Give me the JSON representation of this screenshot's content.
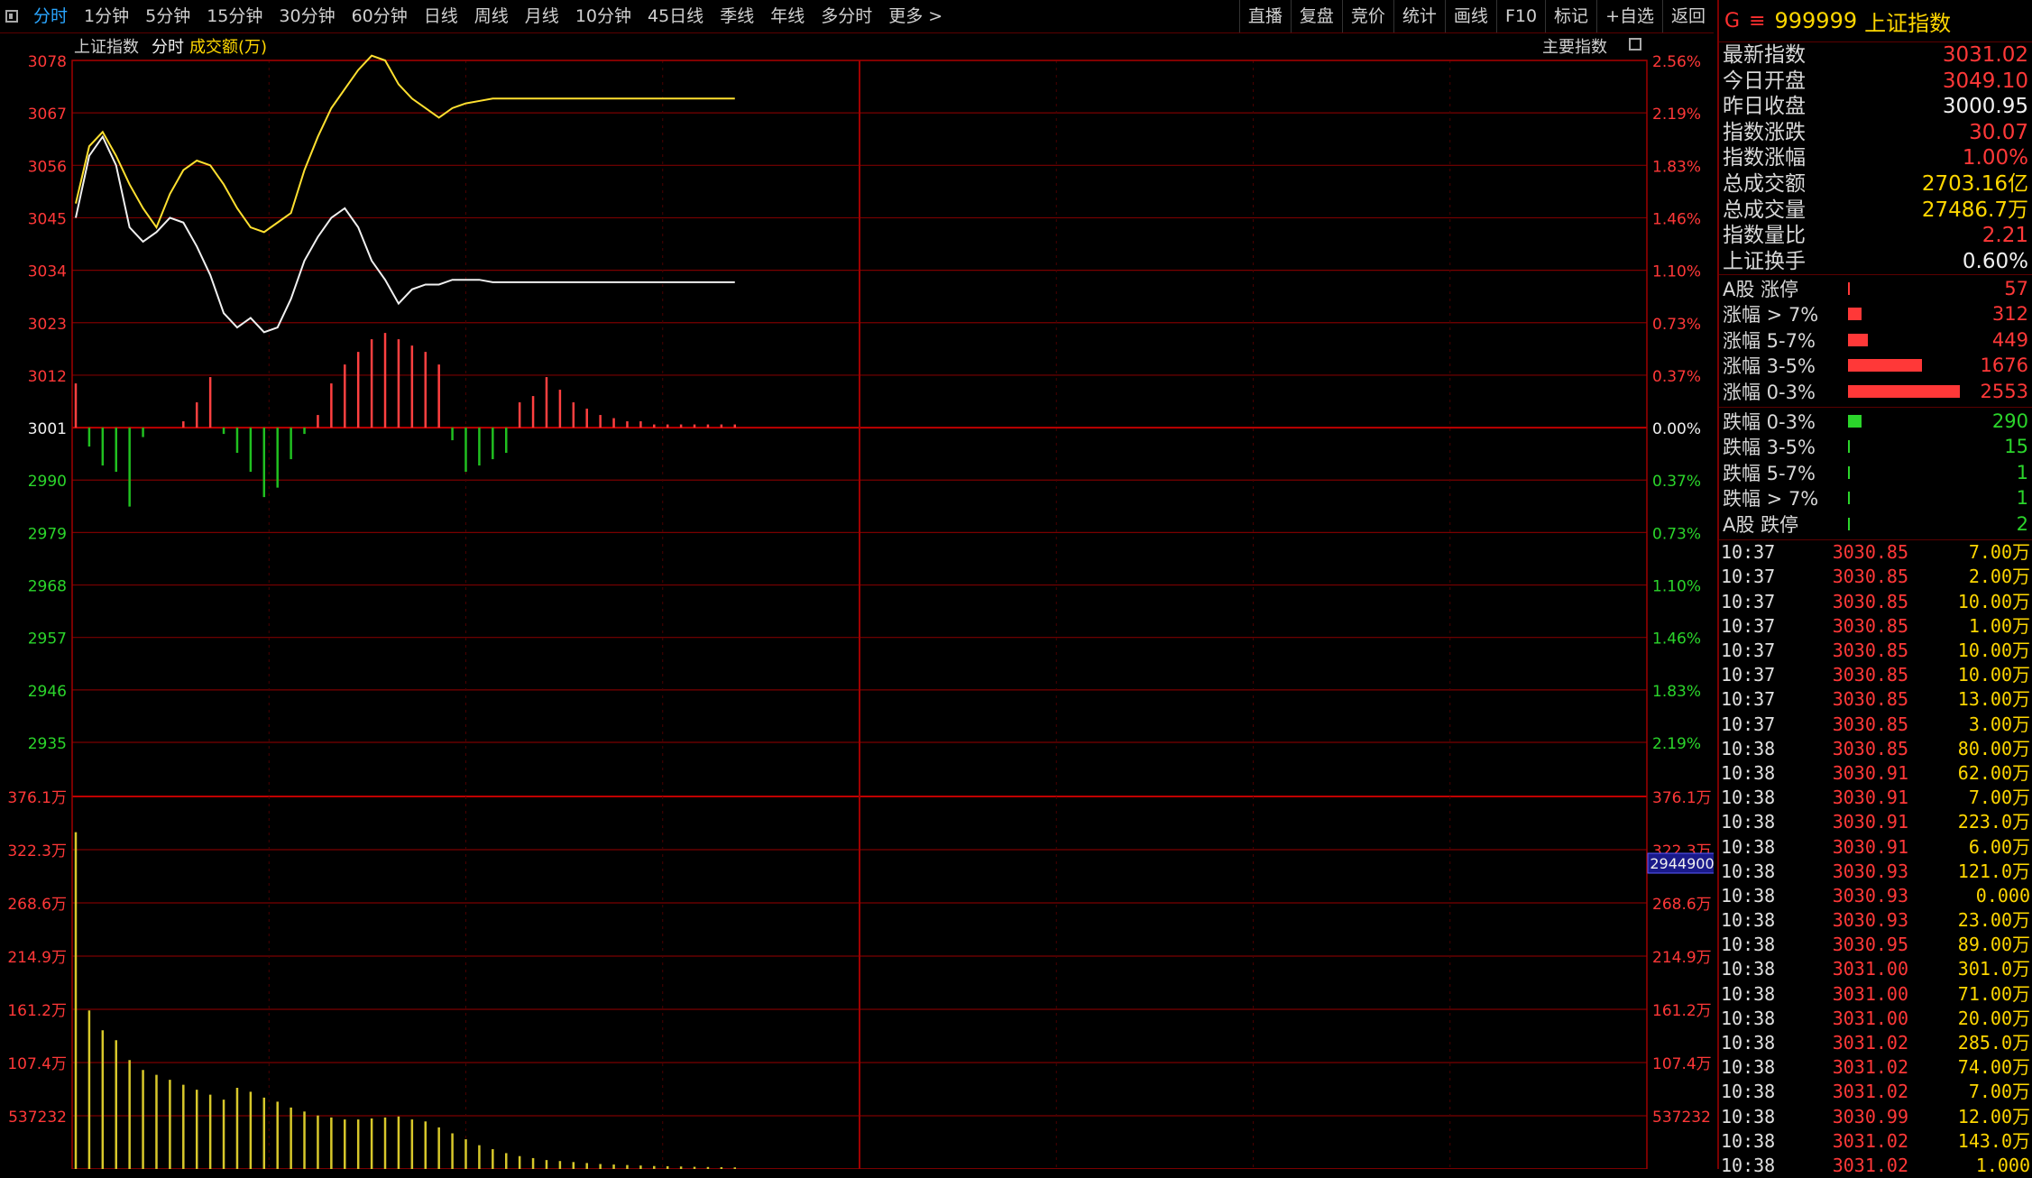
{
  "toolbar": {
    "tabs": [
      "分时",
      "1分钟",
      "5分钟",
      "15分钟",
      "30分钟",
      "60分钟",
      "日线",
      "周线",
      "月线",
      "10分钟",
      "45日线",
      "季线",
      "年线",
      "多分时",
      "更多 >"
    ],
    "active_tab": "分时",
    "right_tools": [
      "直播",
      "复盘",
      "竞价",
      "统计",
      "画线",
      "F10",
      "标记",
      "+自选",
      "返回"
    ]
  },
  "chart_header": {
    "index_name": "上证指数",
    "period": "分时",
    "volume_label": "成交额(万)",
    "main_index_label": "主要指数"
  },
  "chart_data": {
    "type": "line",
    "price_axis": {
      "ticks": [
        3078,
        3067,
        3056,
        3045,
        3034,
        3023,
        3012,
        3001,
        2990,
        2979,
        2968,
        2957,
        2946,
        2935
      ],
      "pct_ticks": [
        "2.56%",
        "2.19%",
        "1.83%",
        "1.46%",
        "1.10%",
        "0.73%",
        "0.37%",
        "0.00%",
        "0.37%",
        "0.73%",
        "1.10%",
        "1.46%",
        "1.83%",
        "2.19%"
      ],
      "ylim": [
        2935,
        3078
      ],
      "prev_close": 3001
    },
    "volume_axis": {
      "ticks": [
        "376.1万",
        "322.3万",
        "268.6万",
        "214.9万",
        "161.2万",
        "107.4万",
        "537232"
      ],
      "ylim": [
        0,
        3761000
      ],
      "current_marker": "2944900"
    },
    "x_range": [
      0,
      240
    ],
    "series": [
      {
        "name": "",
        "color": "#ffe030",
        "values": [
          3048,
          3060,
          3063,
          3058,
          3052,
          3047,
          3043,
          3050,
          3055,
          3057,
          3056,
          3052,
          3047,
          3043,
          3042,
          3044,
          3046,
          3055,
          3062,
          3068,
          3072,
          3076,
          3079,
          3078,
          3073,
          3070,
          3068,
          3066,
          3068,
          3069,
          3069.5,
          3070,
          3070,
          3070,
          3070,
          3070,
          3070,
          3070,
          3070,
          3070,
          3070,
          3070,
          3070,
          3070,
          3070,
          3070,
          3070,
          3070,
          3070,
          3070
        ]
      },
      {
        "name": "",
        "color": "#f0f0f0",
        "values": [
          3045,
          3058,
          3062,
          3056,
          3043,
          3040,
          3042,
          3045,
          3044,
          3039,
          3033,
          3025,
          3022,
          3024,
          3021,
          3022,
          3028,
          3036,
          3041,
          3045,
          3047,
          3043,
          3036,
          3032,
          3027,
          3030,
          3031,
          3031,
          3032,
          3032,
          3032,
          3031.5,
          3031.5,
          3031.5,
          3031.5,
          3031.5,
          3031.5,
          3031.5,
          3031.5,
          3031.5,
          3031.5,
          3031.5,
          3031.5,
          3031.5,
          3031.5,
          3031.5,
          3031.5,
          3031.5,
          3031.5,
          3031.5
        ]
      }
    ],
    "breadth_bars": [
      14,
      -6,
      -12,
      -14,
      -25,
      -3,
      0,
      0,
      2,
      8,
      16,
      -2,
      -8,
      -14,
      -22,
      -19,
      -10,
      -2,
      4,
      14,
      20,
      24,
      28,
      30,
      28,
      26,
      24,
      20,
      -4,
      -14,
      -12,
      -10,
      -8,
      8,
      10,
      16,
      12,
      8,
      6,
      4,
      3,
      2,
      2,
      1,
      1,
      1,
      1,
      1,
      1,
      1
    ],
    "volume_bars": [
      3400000,
      1600000,
      1400000,
      1300000,
      1100000,
      1000000,
      950000,
      900000,
      850000,
      800000,
      750000,
      700000,
      820000,
      780000,
      720000,
      680000,
      620000,
      580000,
      540000,
      520000,
      500000,
      500000,
      510000,
      520000,
      530000,
      500000,
      480000,
      420000,
      360000,
      300000,
      240000,
      200000,
      160000,
      130000,
      110000,
      90000,
      80000,
      70000,
      60000,
      50000,
      45000,
      40000,
      35000,
      30000,
      28000,
      25000,
      22000,
      20000,
      18000,
      16000
    ]
  },
  "right_panel": {
    "code": "999999",
    "name": "上证指数",
    "g_label": "G",
    "stats": [
      {
        "label": "最新指数",
        "value": "3031.02",
        "color": "red"
      },
      {
        "label": "今日开盘",
        "value": "3049.10",
        "color": "red"
      },
      {
        "label": "昨日收盘",
        "value": "3000.95",
        "color": "white"
      },
      {
        "label": "指数涨跌",
        "value": "30.07",
        "color": "red"
      },
      {
        "label": "指数涨幅",
        "value": "1.00%",
        "color": "red"
      },
      {
        "label": "总成交额",
        "value": "2703.16亿",
        "color": "yellow"
      },
      {
        "label": "总成交量",
        "value": "27486.7万",
        "color": "yellow"
      },
      {
        "label": "指数量比",
        "value": "2.21",
        "color": "red"
      },
      {
        "label": "上证换手",
        "value": "0.60%",
        "color": "white"
      }
    ],
    "up_dist": [
      {
        "label": "A股 涨停",
        "value": "57",
        "frac": 0.02
      },
      {
        "label": "涨幅 > 7%",
        "value": "312",
        "frac": 0.12
      },
      {
        "label": "涨幅 5-7%",
        "value": "449",
        "frac": 0.18
      },
      {
        "label": "涨幅 3-5%",
        "value": "1676",
        "frac": 0.66
      },
      {
        "label": "涨幅 0-3%",
        "value": "2553",
        "frac": 1.0
      }
    ],
    "down_dist": [
      {
        "label": "跌幅 0-3%",
        "value": "290",
        "frac": 0.12
      },
      {
        "label": "跌幅 3-5%",
        "value": "15",
        "frac": 0.02
      },
      {
        "label": "跌幅 5-7%",
        "value": "1",
        "frac": 0.02
      },
      {
        "label": "跌幅 > 7%",
        "value": "1",
        "frac": 0.02
      },
      {
        "label": "A股 跌停",
        "value": "2",
        "frac": 0.02
      }
    ],
    "ticks": [
      [
        "10:37",
        "3030.85",
        "7.00万"
      ],
      [
        "10:37",
        "3030.85",
        "2.00万"
      ],
      [
        "10:37",
        "3030.85",
        "10.00万"
      ],
      [
        "10:37",
        "3030.85",
        "1.00万"
      ],
      [
        "10:37",
        "3030.85",
        "10.00万"
      ],
      [
        "10:37",
        "3030.85",
        "10.00万"
      ],
      [
        "10:37",
        "3030.85",
        "13.00万"
      ],
      [
        "10:37",
        "3030.85",
        "3.00万"
      ],
      [
        "10:38",
        "3030.85",
        "80.00万"
      ],
      [
        "10:38",
        "3030.91",
        "62.00万"
      ],
      [
        "10:38",
        "3030.91",
        "7.00万"
      ],
      [
        "10:38",
        "3030.91",
        "223.0万"
      ],
      [
        "10:38",
        "3030.91",
        "6.00万"
      ],
      [
        "10:38",
        "3030.93",
        "121.0万"
      ],
      [
        "10:38",
        "3030.93",
        "0.000"
      ],
      [
        "10:38",
        "3030.93",
        "23.00万"
      ],
      [
        "10:38",
        "3030.95",
        "89.00万"
      ],
      [
        "10:38",
        "3031.00",
        "301.0万"
      ],
      [
        "10:38",
        "3031.00",
        "71.00万"
      ],
      [
        "10:38",
        "3031.00",
        "20.00万"
      ],
      [
        "10:38",
        "3031.02",
        "285.0万"
      ],
      [
        "10:38",
        "3031.02",
        "74.00万"
      ],
      [
        "10:38",
        "3031.02",
        "7.00万"
      ],
      [
        "10:38",
        "3030.99",
        "12.00万"
      ],
      [
        "10:38",
        "3031.02",
        "143.0万"
      ],
      [
        "10:38",
        "3031.02",
        "1.000"
      ]
    ],
    "colors": {
      "red": "#ff3838",
      "green": "#2bd52b",
      "yellow": "#ffd700",
      "white": "#f0f0f0"
    }
  }
}
